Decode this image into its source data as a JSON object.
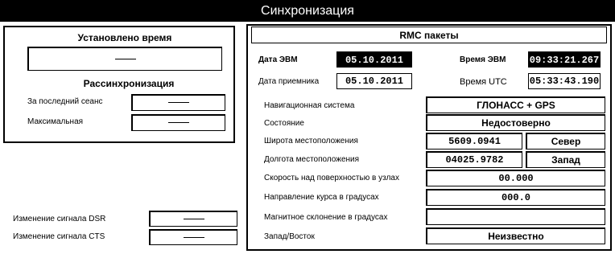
{
  "window": {
    "title": "Синхронизация"
  },
  "left": {
    "set_time": {
      "heading": "Установлено время",
      "value": "—"
    },
    "desync": {
      "heading": "Рассинхронизация",
      "last_session_label": "За последний сеанс",
      "last_session_value": "—",
      "max_label": "Максимальная",
      "max_value": "—"
    },
    "dsr_label": "Изменение сигнала DSR",
    "dsr_value": "—",
    "cts_label": "Изменение сигнала CTS",
    "cts_value": "—"
  },
  "rmc": {
    "title": "RMC пакеты",
    "date_evm_label": "Дата ЭВМ",
    "date_evm_value": "05.10.2011",
    "time_evm_label": "Время ЭВМ",
    "time_evm_value": "09:33:21.267",
    "date_rx_label": "Дата приемника",
    "date_rx_value": "05.10.2011",
    "time_utc_label": "Время UTC",
    "time_utc_value": "05:33:43.190",
    "nav_system_label": "Навигационная система",
    "nav_system_value": "ГЛОНАСС + GPS",
    "state_label": "Состояние",
    "state_value": "Недостоверно",
    "latitude_label": "Широта местоположения",
    "latitude_value": "5609.0941",
    "latitude_dir": "Север",
    "longitude_label": "Долгота местоположения",
    "longitude_value": "04025.9782",
    "longitude_dir": "Запад",
    "speed_label": "Скорость над поверхностью в узлах",
    "speed_value": "00.000",
    "course_label": "Направление курса в градусах",
    "course_value": "000.0",
    "mag_var_label": "Магнитное склонение в градусах",
    "mag_var_value": "",
    "west_east_label": "Запад/Восток",
    "west_east_value": "Неизвестно"
  }
}
